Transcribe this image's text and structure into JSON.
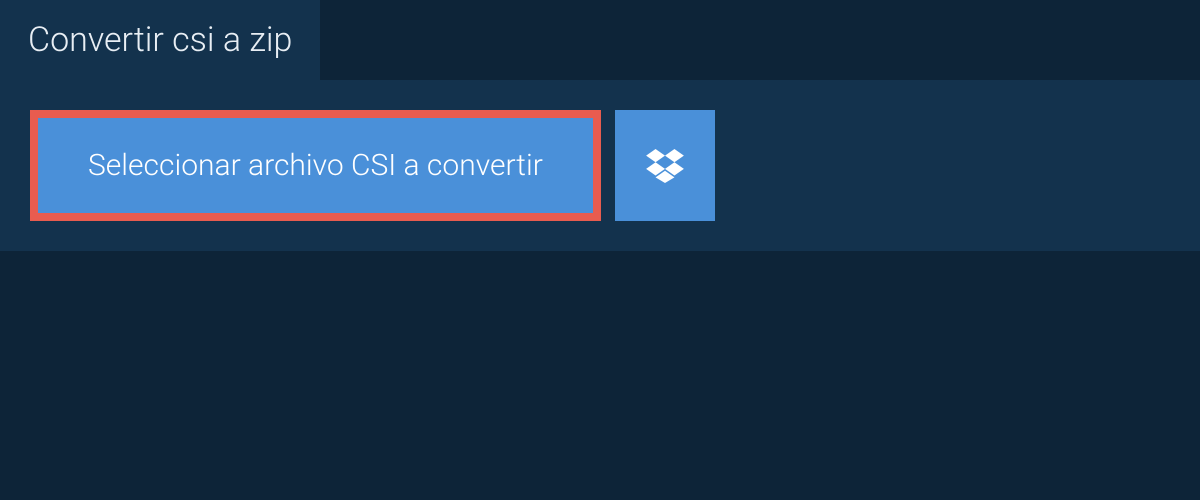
{
  "tab": {
    "title": "Convertir csi a zip"
  },
  "buttons": {
    "selectFile": "Seleccionar archivo CSI a convertir"
  },
  "colors": {
    "background": "#0d2438",
    "panel": "#13324d",
    "primaryButton": "#4a90d9",
    "highlight": "#e85c4f",
    "textLight": "#e8eef4",
    "textWhite": "#ffffff"
  }
}
